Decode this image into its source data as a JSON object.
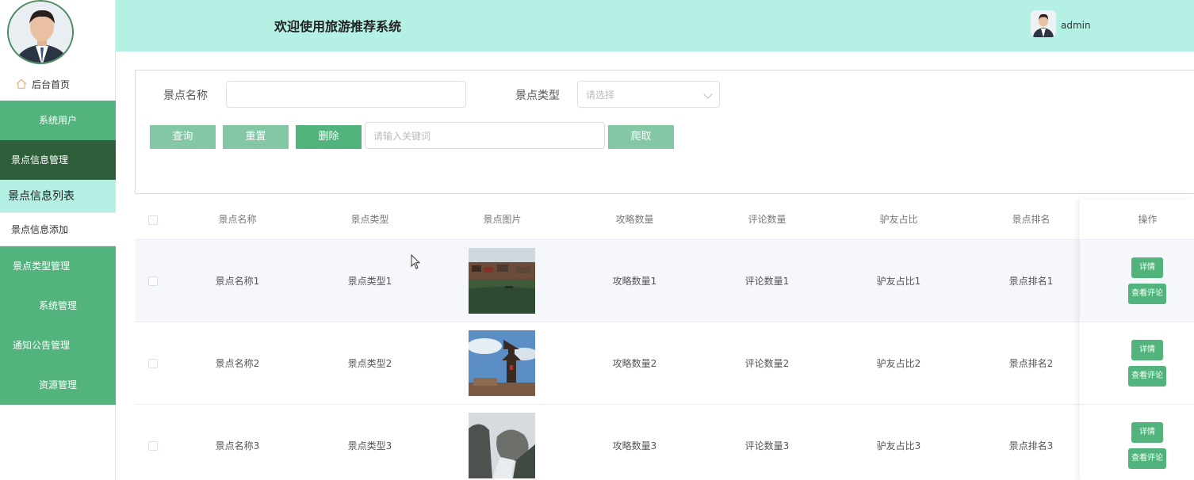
{
  "header": {
    "title": "欢迎使用旅游推荐系统",
    "username": "admin"
  },
  "sidebar": {
    "home_label": "后台首页",
    "items": [
      {
        "label": "系统用户"
      },
      {
        "label": "景点信息管理"
      },
      {
        "label": "景点信息列表"
      },
      {
        "label": "景点信息添加"
      },
      {
        "label": "景点类型管理"
      },
      {
        "label": "系统管理"
      },
      {
        "label": "通知公告管理"
      },
      {
        "label": "资源管理"
      }
    ]
  },
  "search": {
    "name_label": "景点名称",
    "name_value": "",
    "type_label": "景点类型",
    "type_placeholder": "请选择",
    "keyword_placeholder": "请输入关键词",
    "buttons": {
      "query": "查询",
      "reset": "重置",
      "delete": "删除",
      "crawl": "爬取"
    }
  },
  "table": {
    "columns": [
      "景点名称",
      "景点类型",
      "景点图片",
      "攻略数量",
      "评论数量",
      "驴友占比",
      "景点排名",
      "操作"
    ],
    "rows": [
      {
        "name": "景点名称1",
        "type": "景点类型1",
        "image": "water-town-photo",
        "guides": "攻略数量1",
        "comments": "评论数量1",
        "ratio": "驴友占比1",
        "rank": "景点排名1"
      },
      {
        "name": "景点名称2",
        "type": "景点类型2",
        "image": "pagoda-photo",
        "guides": "攻略数量2",
        "comments": "评论数量2",
        "ratio": "驴友占比2",
        "rank": "景点排名2"
      },
      {
        "name": "景点名称3",
        "type": "景点类型3",
        "image": "rock-mountain-photo",
        "guides": "攻略数量3",
        "comments": "评论数量3",
        "ratio": "驴友占比3",
        "rank": "景点排名3"
      }
    ],
    "actions": {
      "detail": "详情",
      "view_comments": "查看评论"
    }
  },
  "colors": {
    "header_bg": "#b5f0e4",
    "menu_green": "#52b47c",
    "menu_active": "#2f5f3a",
    "button_light": "#83c7a7"
  }
}
